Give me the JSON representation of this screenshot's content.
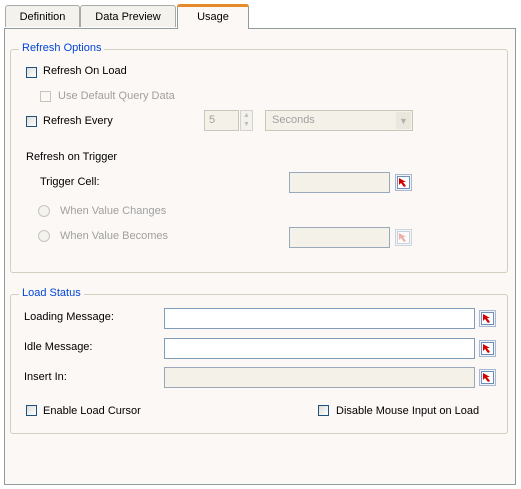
{
  "tabs": [
    {
      "label": "Definition",
      "active": false
    },
    {
      "label": "Data Preview",
      "active": false
    },
    {
      "label": "Usage",
      "active": true
    }
  ],
  "refresh_options": {
    "legend": "Refresh Options",
    "refresh_on_load": {
      "label": "Refresh On Load",
      "checked": false
    },
    "use_default_query_data": {
      "label": "Use Default Query Data",
      "checked": false,
      "enabled": false
    },
    "refresh_every": {
      "label": "Refresh Every",
      "checked": false
    },
    "interval_value": "5",
    "interval_unit": "Seconds",
    "refresh_on_trigger_label": "Refresh on Trigger",
    "trigger_cell_label": "Trigger Cell:",
    "when_value_changes": "When Value Changes",
    "when_value_becomes": "When Value Becomes"
  },
  "load_status": {
    "legend": "Load Status",
    "loading_message_label": "Loading Message:",
    "loading_message_value": "",
    "idle_message_label": "Idle Message:",
    "idle_message_value": "",
    "insert_in_label": "Insert In:",
    "insert_in_value": "",
    "enable_load_cursor": {
      "label": "Enable Load Cursor",
      "checked": false
    },
    "disable_mouse_input": {
      "label": "Disable Mouse Input on Load",
      "checked": false
    }
  },
  "colors": {
    "legend": "#0046d5",
    "panel_bg": "#fcf8f5",
    "active_tab_accent": "#e68b2c",
    "picker_arrow": "#d40000"
  },
  "icons": {
    "cell_picker": "cell-selector-arrow-icon"
  }
}
